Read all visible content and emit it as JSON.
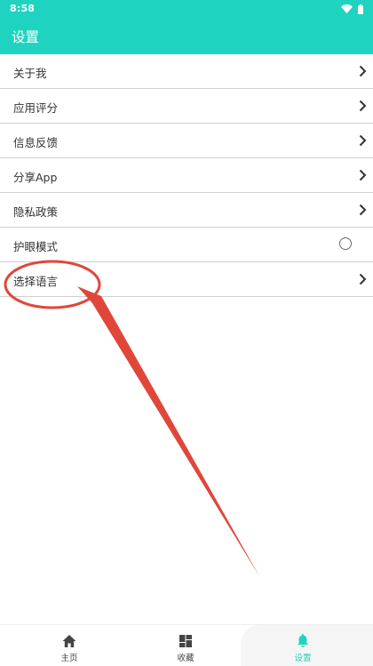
{
  "status_bar": {
    "time": "8:58"
  },
  "app_bar": {
    "title": "设置"
  },
  "settings": {
    "items": [
      {
        "label": "关于我"
      },
      {
        "label": "应用评分"
      },
      {
        "label": "信息反馈"
      },
      {
        "label": "分享App"
      },
      {
        "label": "隐私政策"
      },
      {
        "label": "护眼模式"
      },
      {
        "label": "选择语言"
      }
    ],
    "eye_mode_enabled": false
  },
  "bottom_nav": {
    "tabs": [
      {
        "label": "主页",
        "icon": "home-icon"
      },
      {
        "label": "收藏",
        "icon": "grid-icon"
      },
      {
        "label": "设置",
        "icon": "bell-icon"
      }
    ],
    "active_tab": 2
  },
  "colors": {
    "accent": "#1ed4c0",
    "annotation": "#e0473a"
  }
}
